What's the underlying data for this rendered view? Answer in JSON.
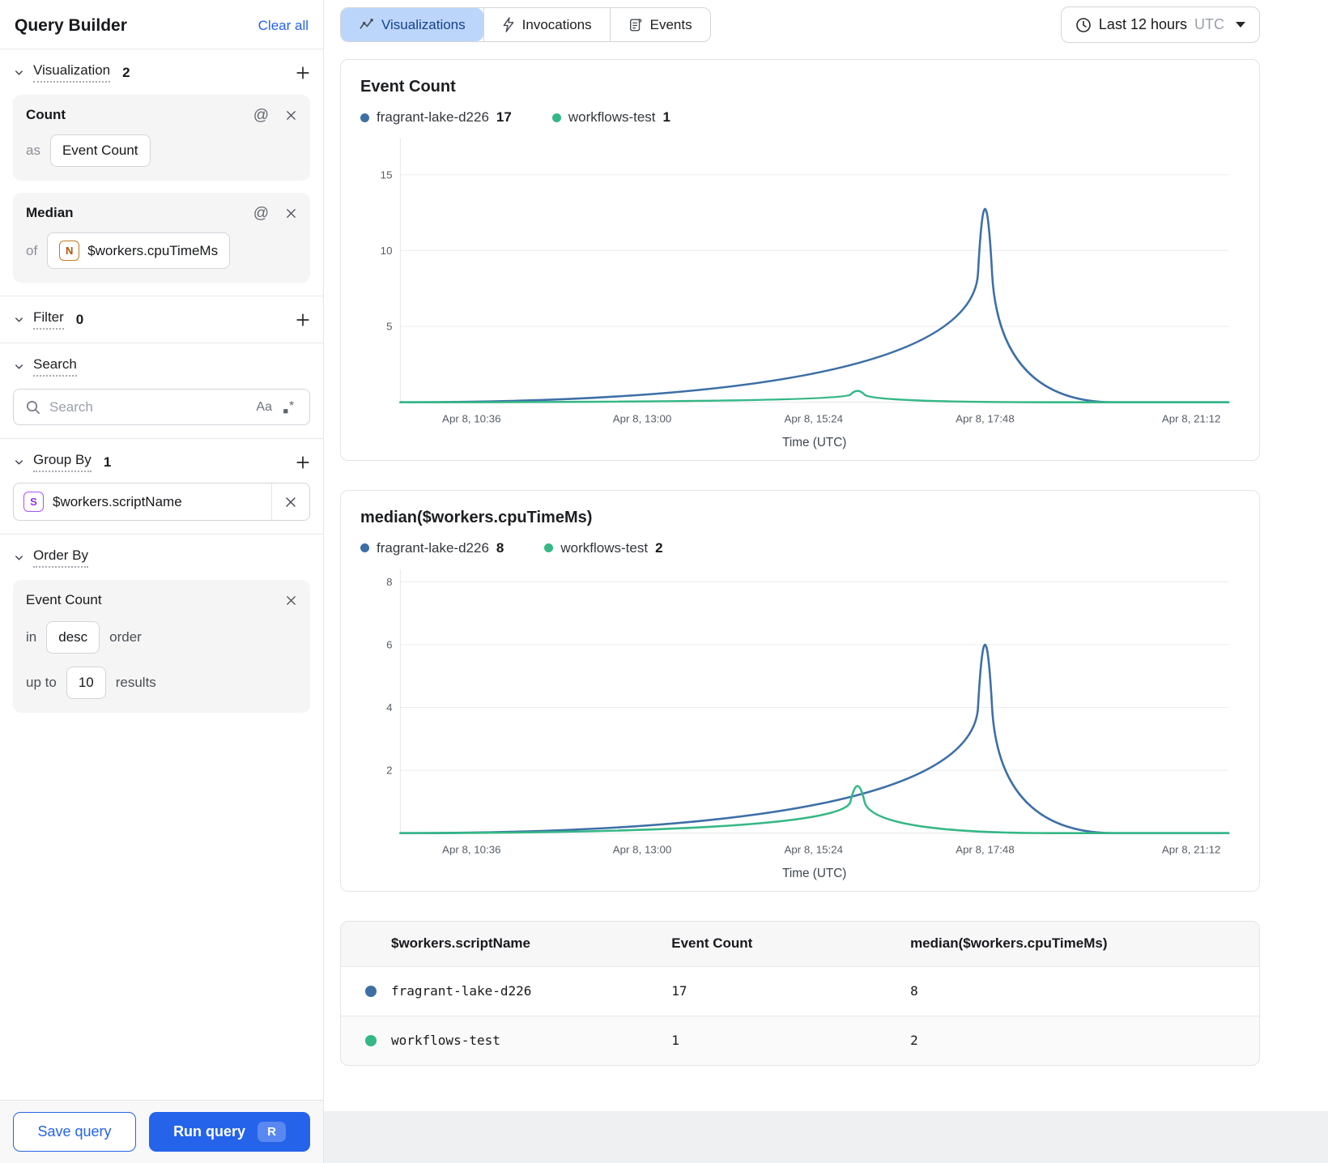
{
  "sidebar": {
    "title": "Query Builder",
    "clear_all": "Clear all",
    "visualization": {
      "label": "Visualization",
      "count": "2"
    },
    "cards": [
      {
        "title": "Count",
        "connector": "as",
        "chip": "Event Count"
      },
      {
        "title": "Median",
        "connector": "of",
        "chip": "$workers.cpuTimeMs",
        "type_letter": "N"
      }
    ],
    "filter": {
      "label": "Filter",
      "count": "0"
    },
    "search": {
      "label": "Search",
      "placeholder": "Search",
      "case_toggle": "Aa"
    },
    "group_by": {
      "label": "Group By",
      "count": "1",
      "chip": "$workers.scriptName",
      "type_letter": "S"
    },
    "order_by": {
      "label": "Order By",
      "field": "Event Count",
      "in_word": "in",
      "direction": "desc",
      "order_word": "order",
      "upto_word": "up to",
      "limit": "10",
      "results_word": "results"
    },
    "footer": {
      "save": "Save query",
      "run": "Run query",
      "shortcut": "R"
    }
  },
  "topbar": {
    "tabs": [
      {
        "label": "Visualizations",
        "selected": true
      },
      {
        "label": "Invocations",
        "selected": false
      },
      {
        "label": "Events",
        "selected": false
      }
    ],
    "time_range": {
      "label": "Last 12 hours",
      "zone": "UTC"
    }
  },
  "table": {
    "columns": [
      "$workers.scriptName",
      "Event Count",
      "median($workers.cpuTimeMs)"
    ],
    "rows": [
      {
        "color": "#3d6fa6",
        "name": "fragrant-lake-d226",
        "event_count": "17",
        "median": "8"
      },
      {
        "color": "#35b786",
        "name": "workflows-test",
        "event_count": "1",
        "median": "2"
      }
    ]
  },
  "chart_data": [
    {
      "type": "line",
      "title": "Event Count",
      "xlabel": "Time (UTC)",
      "ylim": [
        0,
        17.4
      ],
      "yticks": [
        5,
        10,
        15
      ],
      "x_ticks": [
        {
          "label": "Apr 8, 10:36",
          "frac": 0.086
        },
        {
          "label": "Apr 8, 13:00",
          "frac": 0.292
        },
        {
          "label": "Apr 8, 15:24",
          "frac": 0.499
        },
        {
          "label": "Apr 8, 17:48",
          "frac": 0.706
        },
        {
          "label": "Apr 8, 21:12",
          "frac": 0.955
        }
      ],
      "legend": [
        {
          "name": "fragrant-lake-d226",
          "value": 17,
          "color": "#3d6fa6"
        },
        {
          "name": "workflows-test",
          "value": 1,
          "color": "#35b786"
        }
      ],
      "series": [
        {
          "name": "fragrant-lake-d226",
          "color": "#3d6fa6",
          "points": [
            [
              0,
              0
            ],
            [
              0.689,
              0
            ],
            [
              0.706,
              17
            ],
            [
              0.723,
              0
            ],
            [
              1,
              0
            ]
          ]
        },
        {
          "name": "workflows-test",
          "color": "#35b786",
          "points": [
            [
              0,
              0
            ],
            [
              0.535,
              0
            ],
            [
              0.552,
              1
            ],
            [
              0.569,
              0
            ],
            [
              1,
              0
            ]
          ]
        }
      ]
    },
    {
      "type": "line",
      "title": "median($workers.cpuTimeMs)",
      "xlabel": "Time (UTC)",
      "ylim": [
        0,
        8.4
      ],
      "yticks": [
        2,
        4,
        6,
        8
      ],
      "x_ticks": [
        {
          "label": "Apr 8, 10:36",
          "frac": 0.086
        },
        {
          "label": "Apr 8, 13:00",
          "frac": 0.292
        },
        {
          "label": "Apr 8, 15:24",
          "frac": 0.499
        },
        {
          "label": "Apr 8, 17:48",
          "frac": 0.706
        },
        {
          "label": "Apr 8, 21:12",
          "frac": 0.955
        }
      ],
      "legend": [
        {
          "name": "fragrant-lake-d226",
          "value": 8,
          "color": "#3d6fa6"
        },
        {
          "name": "workflows-test",
          "value": 2,
          "color": "#35b786"
        }
      ],
      "series": [
        {
          "name": "fragrant-lake-d226",
          "color": "#3d6fa6",
          "points": [
            [
              0,
              0
            ],
            [
              0.689,
              0
            ],
            [
              0.706,
              8
            ],
            [
              0.723,
              0
            ],
            [
              1,
              0
            ]
          ]
        },
        {
          "name": "workflows-test",
          "color": "#35b786",
          "points": [
            [
              0,
              0
            ],
            [
              0.535,
              0
            ],
            [
              0.552,
              2
            ],
            [
              0.569,
              0
            ],
            [
              1,
              0
            ]
          ]
        }
      ]
    }
  ]
}
